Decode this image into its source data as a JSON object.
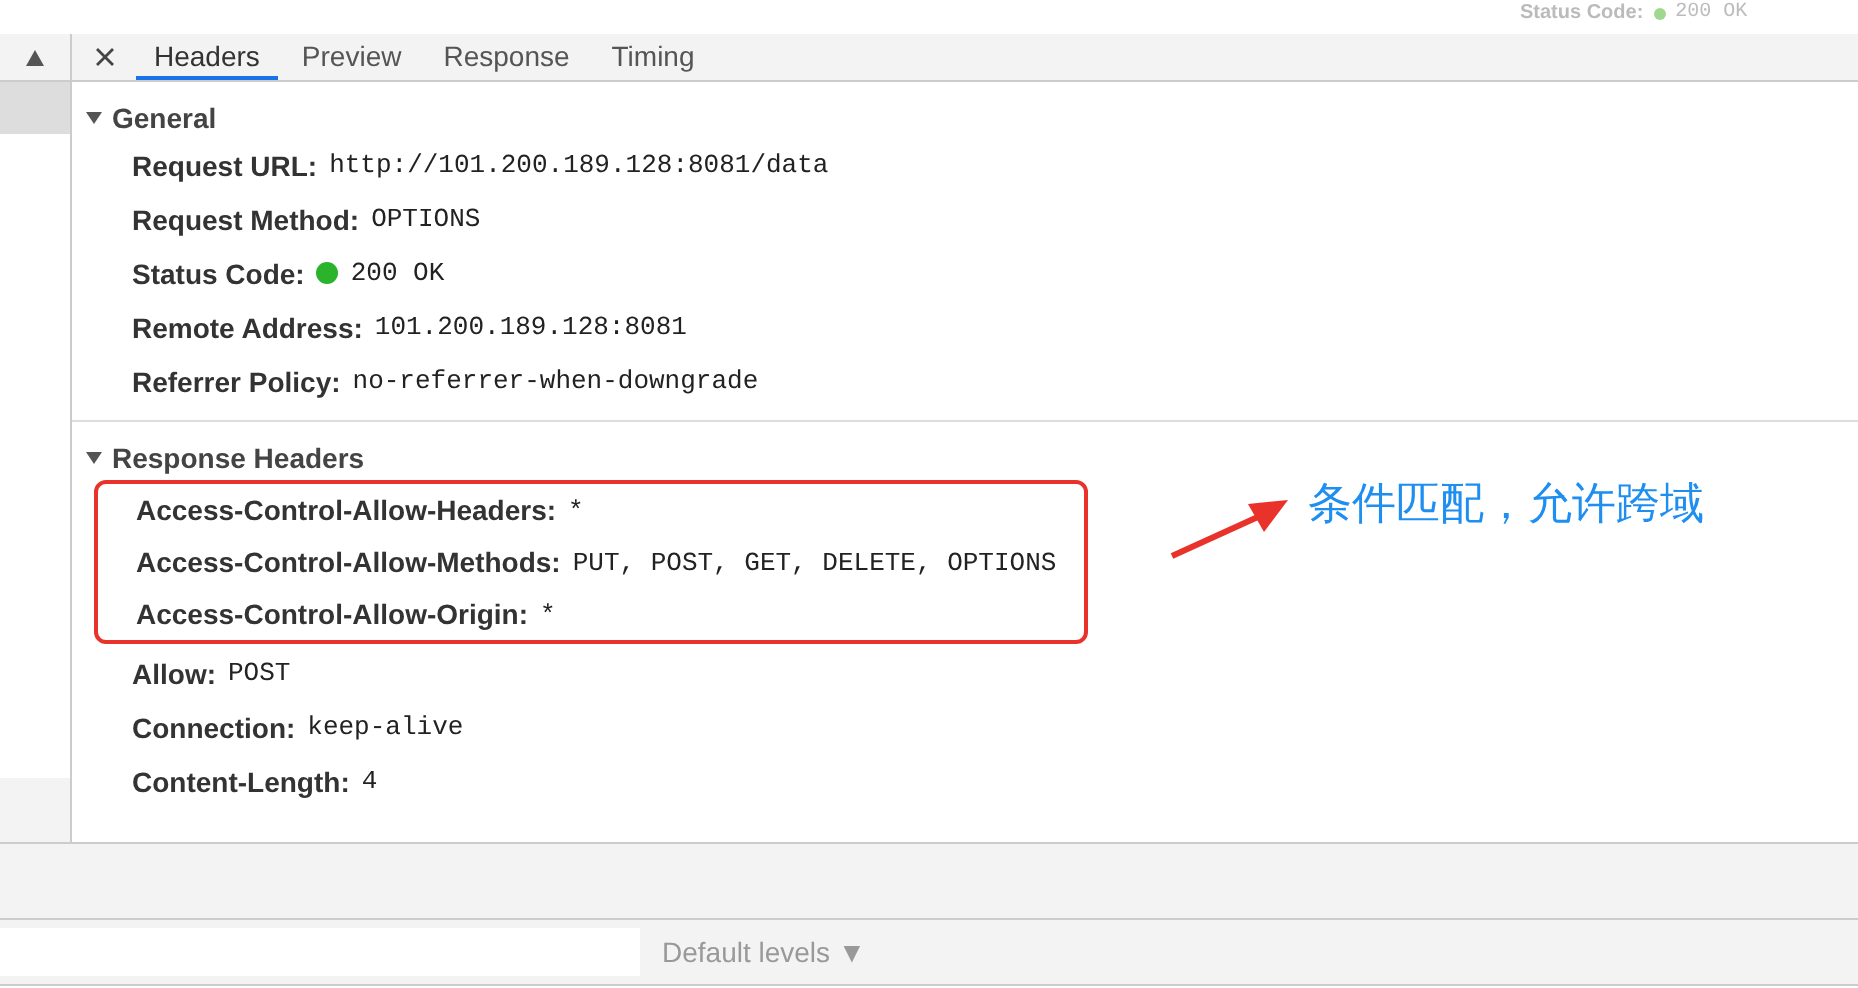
{
  "background_strip": {
    "label": "Status Code:",
    "value": "200 OK"
  },
  "tabs": [
    {
      "label": "Headers",
      "selected": true
    },
    {
      "label": "Preview",
      "selected": false
    },
    {
      "label": "Response",
      "selected": false
    },
    {
      "label": "Timing",
      "selected": false
    }
  ],
  "sections": [
    {
      "title": "General",
      "expanded": true,
      "items": [
        {
          "name": "Request URL:",
          "value": "http://101.200.189.128:8081/data",
          "kind": "plain",
          "highlighted": false
        },
        {
          "name": "Request Method:",
          "value": "OPTIONS",
          "kind": "plain",
          "highlighted": false
        },
        {
          "name": "Status Code:",
          "value": "200 OK",
          "kind": "status",
          "highlighted": false
        },
        {
          "name": "Remote Address:",
          "value": "101.200.189.128:8081",
          "kind": "plain",
          "highlighted": false
        },
        {
          "name": "Referrer Policy:",
          "value": "no-referrer-when-downgrade",
          "kind": "plain",
          "highlighted": false
        }
      ]
    },
    {
      "title": "Response Headers",
      "expanded": true,
      "items": [
        {
          "name": "Access-Control-Allow-Headers:",
          "value": "*",
          "kind": "plain",
          "highlighted": true
        },
        {
          "name": "Access-Control-Allow-Methods:",
          "value": "PUT, POST, GET, DELETE, OPTIONS",
          "kind": "plain",
          "highlighted": true
        },
        {
          "name": "Access-Control-Allow-Origin:",
          "value": "*",
          "kind": "plain",
          "highlighted": true
        },
        {
          "name": "Allow:",
          "value": "POST",
          "kind": "plain",
          "highlighted": false
        },
        {
          "name": "Connection:",
          "value": "keep-alive",
          "kind": "plain",
          "highlighted": false
        },
        {
          "name": "Content-Length:",
          "value": "4",
          "kind": "plain",
          "highlighted": false
        }
      ]
    }
  ],
  "annotation": {
    "text": "条件匹配，允许跨域"
  },
  "console_bar": {
    "levels": "Default levels",
    "caret": "▼"
  }
}
